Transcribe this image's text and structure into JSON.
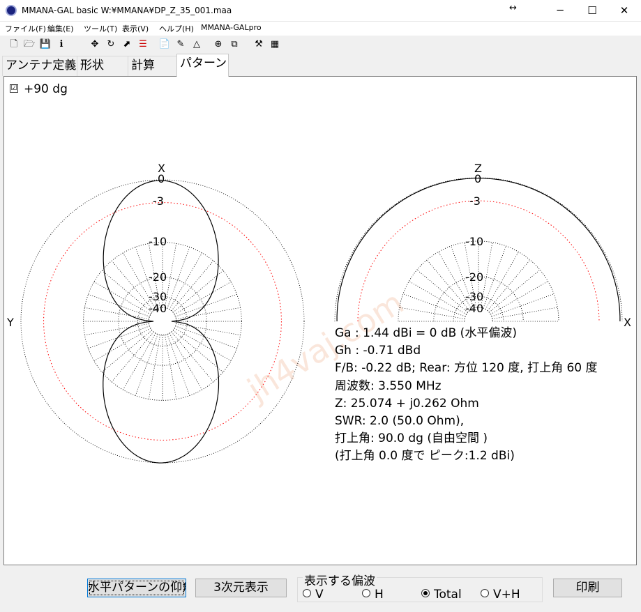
{
  "window": {
    "title": "MMANA-GAL basic  W:¥MMANA¥DP_Z_35_001.maa",
    "resize_icon": "↔",
    "minimize": "─",
    "maximize": "☐",
    "close": "✕"
  },
  "menu": [
    "ファイル(F)",
    "編集(E)",
    "ツール(T)",
    "表示(V)",
    "ヘルプ(H)",
    "MMANA-GALpro"
  ],
  "toolbar": {
    "icons": [
      "new-file-icon",
      "open-folder-icon",
      "save-icon",
      "info-icon",
      "move-icon",
      "rotate-icon",
      "resize-icon",
      "wire-list-icon",
      "document-icon",
      "pen-icon",
      "triangle-icon",
      "target-icon",
      "copy-icon",
      "tools-icon",
      "calculator-icon"
    ],
    "glyphs": [
      "🗋",
      "🗁",
      "💾",
      "ℹ",
      "✥",
      "↻",
      "⬈",
      "☰",
      "📄",
      "✎",
      "△",
      "⊕",
      "⧉",
      "⚒",
      "▦"
    ]
  },
  "tabs": [
    "アンテナ定義",
    "形状",
    "計算",
    "パターン"
  ],
  "plot": {
    "checkbox_label": "+90 dg",
    "checkbox_checked": true,
    "horizontal": {
      "axis_top": "X",
      "axis_left": "Y"
    },
    "vertical": {
      "axis_top": "Z",
      "axis_right": "X"
    },
    "ring_labels": [
      "0",
      "-3",
      "-10",
      "-20",
      "-30",
      "-40"
    ]
  },
  "readout": [
    "Ga : 1.44 dBi = 0 dB  (水平偏波)",
    "Gh : -0.71 dBd",
    "F/B: -0.22 dB; Rear: 方位 120 度,  打上角 60 度",
    "周波数: 3.550 MHz",
    "Z: 25.074 + j0.262 Ohm",
    "SWR: 2.0 (50.0 Ohm),",
    "打上角: 90.0 dg (自由空間 )",
    "(打上角 0.0 度で ピーク:1.2 dBi)"
  ],
  "bottom": {
    "elev_button": "水平パターンの仰角",
    "view3d_button": "3次元表示",
    "polarization_legend": "表示する偏波",
    "radios": [
      {
        "label": "V",
        "checked": false
      },
      {
        "label": "H",
        "checked": false
      },
      {
        "label": "Total",
        "checked": true
      },
      {
        "label": "V+H",
        "checked": false
      }
    ],
    "print_button": "印刷"
  },
  "colors": {
    "pattern": "#000000",
    "grid": "#000000",
    "minus3_ring": "#ff0000",
    "watermark": "#f4c9b0"
  },
  "watermark": "jh4vaj.com"
}
